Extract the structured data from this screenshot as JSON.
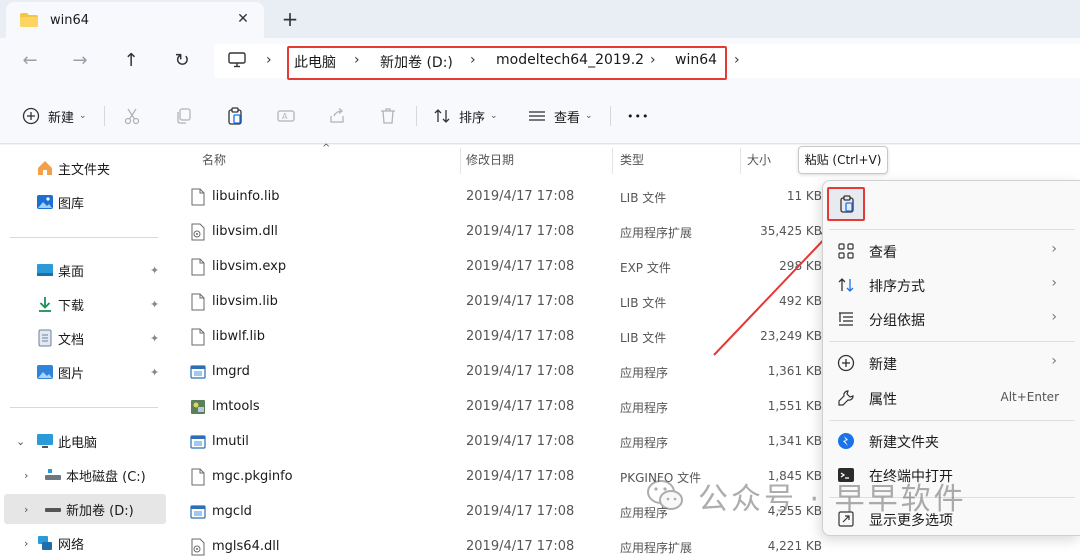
{
  "tab": {
    "title": "win64",
    "close_glyph": "✕",
    "new_tab_glyph": "+"
  },
  "nav": {
    "back": "←",
    "forward": "→",
    "up": "↑",
    "refresh": "↻"
  },
  "breadcrumb": {
    "items": [
      "此电脑",
      "新加卷 (D:)",
      "modeltech64_2019.2",
      "win64"
    ],
    "separator": "›"
  },
  "toolbar": {
    "new_label": "新建",
    "sort_label": "排序",
    "view_label": "查看",
    "more_label": "•••"
  },
  "sidebar": {
    "quick": [
      {
        "label": "主文件夹",
        "icon": "home-icon"
      },
      {
        "label": "图库",
        "icon": "gallery-icon"
      }
    ],
    "pinned": [
      {
        "label": "桌面",
        "icon": "desktop-icon"
      },
      {
        "label": "下载",
        "icon": "download-icon"
      },
      {
        "label": "文档",
        "icon": "document-icon"
      },
      {
        "label": "图片",
        "icon": "picture-icon"
      }
    ],
    "tree": [
      {
        "label": "此电脑",
        "icon": "this-pc-icon",
        "expander": "⌄"
      },
      {
        "label": "本地磁盘 (C:)",
        "icon": "drive-icon",
        "expander": "›"
      },
      {
        "label": "新加卷 (D:)",
        "icon": "drive-icon",
        "expander": "›"
      },
      {
        "label": "网络",
        "icon": "network-icon",
        "expander": "›"
      }
    ],
    "pin_glyph": "📌"
  },
  "columns": {
    "name": "名称",
    "date": "修改日期",
    "type": "类型",
    "size": "大小"
  },
  "files": [
    {
      "name": "libuinfo.lib",
      "date": "2019/4/17 17:08",
      "type": "LIB 文件",
      "size": "11 KB",
      "icon": "file-icon"
    },
    {
      "name": "libvsim.dll",
      "date": "2019/4/17 17:08",
      "type": "应用程序扩展",
      "size": "35,425 KB",
      "icon": "dll-icon"
    },
    {
      "name": "libvsim.exp",
      "date": "2019/4/17 17:08",
      "type": "EXP 文件",
      "size": "298 KB",
      "icon": "file-icon"
    },
    {
      "name": "libvsim.lib",
      "date": "2019/4/17 17:08",
      "type": "LIB 文件",
      "size": "492 KB",
      "icon": "file-icon"
    },
    {
      "name": "libwlf.lib",
      "date": "2019/4/17 17:08",
      "type": "LIB 文件",
      "size": "23,249 KB",
      "icon": "file-icon"
    },
    {
      "name": "lmgrd",
      "date": "2019/4/17 17:08",
      "type": "应用程序",
      "size": "1,361 KB",
      "icon": "exe-icon"
    },
    {
      "name": "lmtools",
      "date": "2019/4/17 17:08",
      "type": "应用程序",
      "size": "1,551 KB",
      "icon": "lmtools-icon"
    },
    {
      "name": "lmutil",
      "date": "2019/4/17 17:08",
      "type": "应用程序",
      "size": "1,341 KB",
      "icon": "exe-icon"
    },
    {
      "name": "mgc.pkginfo",
      "date": "2019/4/17 17:08",
      "type": "PKGINFO 文件",
      "size": "1,845 KB",
      "icon": "file-icon"
    },
    {
      "name": "mgcld",
      "date": "2019/4/17 17:08",
      "type": "应用程序",
      "size": "4,255 KB",
      "icon": "exe-icon"
    },
    {
      "name": "mgls64.dll",
      "date": "2019/4/17 17:08",
      "type": "应用程序扩展",
      "size": "4,221 KB",
      "icon": "dll-icon"
    }
  ],
  "tooltip": {
    "text": "粘贴 (Ctrl+V)"
  },
  "context_menu": {
    "items": [
      {
        "label": "查看",
        "icon": "grid-icon",
        "arrow": "›"
      },
      {
        "label": "排序方式",
        "icon": "sort-icon",
        "arrow": "›"
      },
      {
        "label": "分组依据",
        "icon": "group-icon",
        "arrow": "›"
      },
      {
        "label": "新建",
        "icon": "plus-circle-icon",
        "arrow": "›"
      },
      {
        "label": "属性",
        "icon": "wrench-icon",
        "shortcut": "Alt+Enter"
      },
      {
        "label": "新建文件夹",
        "icon": "new-folder-icon"
      },
      {
        "label": "在终端中打开",
        "icon": "terminal-icon"
      },
      {
        "label": "显示更多选项",
        "icon": "more-options-icon"
      }
    ]
  },
  "watermark": {
    "text": "公众号 · 早早软件"
  },
  "colors": {
    "highlight_red": "#e53935",
    "accent_blue": "#1a73e8"
  }
}
